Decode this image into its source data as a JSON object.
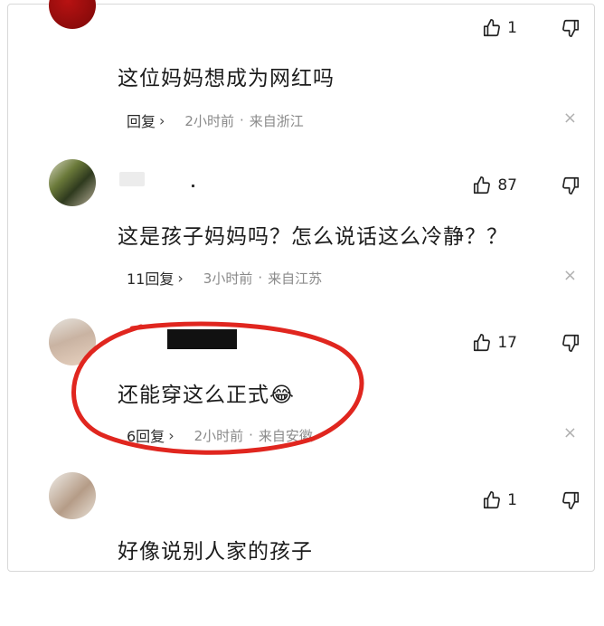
{
  "comments": [
    {
      "text": "这位妈妈想成为网红吗",
      "likes": "1",
      "reply_label": "回复",
      "time": "2小时前",
      "location": "来自浙江",
      "separator": "·"
    },
    {
      "text": "这是孩子妈妈吗？怎么说话这么冷静？？",
      "likes": "87",
      "reply_label": "11回复",
      "time": "3小时前",
      "location": "来自江苏",
      "separator": "·"
    },
    {
      "text": "还能穿这么正式",
      "emoji": "😂",
      "likes": "17",
      "reply_label": "6回复",
      "time": "2小时前",
      "location": "来自安徽",
      "separator": "·"
    },
    {
      "text": "好像说别人家的孩子",
      "likes": "1"
    }
  ],
  "icons": {
    "like": "thumbs-up-outline",
    "dislike": "thumbs-down-outline",
    "close": "×",
    "chevron": "›"
  },
  "colors": {
    "annotation": "#e0261f",
    "meta_text": "#8a8a8a"
  }
}
